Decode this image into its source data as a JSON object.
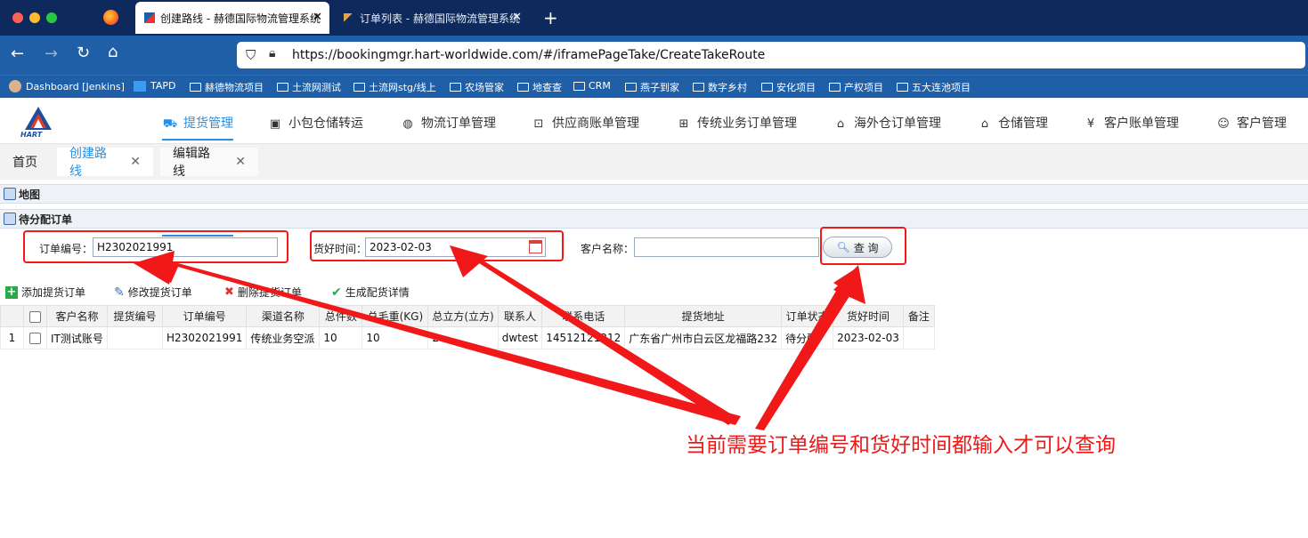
{
  "browser": {
    "tabs": [
      {
        "title": "创建路线 - 赫德国际物流管理系统",
        "active": true
      },
      {
        "title": "订单列表 - 赫德国际物流管理系统",
        "active": false
      }
    ],
    "new_tab": "+",
    "close": "✕",
    "url": "https://bookingmgr.hart-worldwide.com/#/iframePageTake/CreateTakeRoute"
  },
  "bookmarks": [
    "Dashboard [Jenkins]",
    "TAPD",
    "赫德物流项目",
    "土流网测试",
    "土流网stg/线上",
    "农场管家",
    "地查查",
    "CRM",
    "燕子到家",
    "数字乡村",
    "安化项目",
    "产权项目",
    "五大连池项目"
  ],
  "app": {
    "logo_text": "HART",
    "menu": [
      {
        "label": "提货管理",
        "icon": "truck-icon",
        "glyph": "⛟",
        "active": true
      },
      {
        "label": "小包仓储转运",
        "icon": "box-icon",
        "glyph": "▣"
      },
      {
        "label": "物流订单管理",
        "icon": "globe-icon",
        "glyph": "◍"
      },
      {
        "label": "供应商账单管理",
        "icon": "bill-icon",
        "glyph": "⊡"
      },
      {
        "label": "传统业务订单管理",
        "icon": "sitemap-icon",
        "glyph": "⊞"
      },
      {
        "label": "海外仓订单管理",
        "icon": "home-icon",
        "glyph": "⌂"
      },
      {
        "label": "仓储管理",
        "icon": "warehouse-icon",
        "glyph": "⌂"
      },
      {
        "label": "客户账单管理",
        "icon": "yen-icon",
        "glyph": "¥"
      },
      {
        "label": "客户管理",
        "icon": "users-icon",
        "glyph": "☺"
      }
    ],
    "page_tabs": [
      {
        "label": "首页"
      },
      {
        "label": "创建路线",
        "closable": true,
        "active": true
      },
      {
        "label": "编辑路线",
        "closable": true
      }
    ]
  },
  "panels": {
    "map": "地图",
    "pending": "待分配订单"
  },
  "search": {
    "order_no_label": "订单编号：",
    "order_no_value": "H2302021991",
    "ready_time_label": "货好时间：",
    "ready_time_value": "2023-02-03",
    "customer_label": "客户名称：",
    "customer_value": "",
    "query_button": "查 询"
  },
  "toolbar": [
    "添加提货订单",
    "修改提货订单",
    "删除提货订单",
    "生成配货详情"
  ],
  "table": {
    "columns": [
      "客户名称",
      "提货编号",
      "订单编号",
      "渠道名称",
      "总件数",
      "总毛重(KG)",
      "总立方(立方)",
      "联系人",
      "联系电话",
      "提货地址",
      "订单状态",
      "货好时间",
      "备注"
    ],
    "rows": [
      {
        "index": "1",
        "cells": [
          "IT测试账号",
          "",
          "H2302021991",
          "传统业务空派",
          "10",
          "10",
          "2",
          "dwtest",
          "14512121212",
          "广东省广州市白云区龙福路232",
          "待分配",
          "2023-02-03",
          ""
        ]
      }
    ]
  },
  "annotation": "当前需要订单编号和货好时间都输入才可以查询",
  "colors": {
    "chrome": "#0e2a5c",
    "nav": "#1f5fa8",
    "accent": "#2a8fe0",
    "annotation": "#f01818"
  }
}
